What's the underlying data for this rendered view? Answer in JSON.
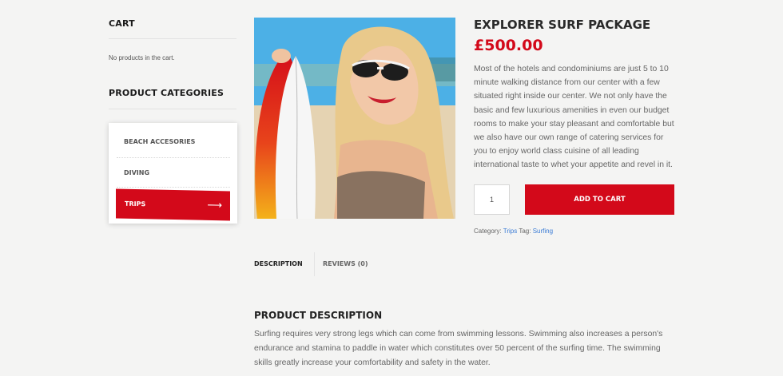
{
  "sidebar": {
    "cart_title": "CART",
    "cart_empty": "No products in the cart.",
    "categories_title": "PRODUCT CATEGORIES",
    "categories": [
      {
        "label": "BEACH ACCESORIES"
      },
      {
        "label": "DIVING"
      },
      {
        "label": "TRIPS"
      }
    ],
    "active_arrow_icon": "arrow-right-icon"
  },
  "product": {
    "title": "EXPLORER SURF PACKAGE",
    "price": "£500.00",
    "description": "Most of the hotels and condominiums are just 5 to 10 minute walking distance from our center with a few situated right inside our center. We not only have the basic and few luxurious amenities in even our budget rooms to make your stay pleasant and comfortable but we also have our own range of catering services for you to enjoy world class cuisine of all leading international taste to whet your appetite and revel in it.",
    "quantity": "1",
    "add_to_cart": "ADD TO CART",
    "meta": {
      "category_label": "Category:",
      "category": "Trips",
      "tag_label": "Tag:",
      "tag": "Surfing"
    }
  },
  "tabs": [
    {
      "label": "DESCRIPTION"
    },
    {
      "label": "REVIEWS (0)"
    }
  ],
  "description_section": {
    "title": "PRODUCT DESCRIPTION",
    "text": "Surfing requires very strong legs which can come from swimming lessons. Swimming also increases a person's endurance and stamina to paddle in water which constitutes over 50 percent of the surfing time. The swimming skills greatly increase your comfortability and safety in the water."
  },
  "colors": {
    "accent": "#d3091a",
    "link": "#3a7bd5",
    "background": "#f4f4f3"
  }
}
